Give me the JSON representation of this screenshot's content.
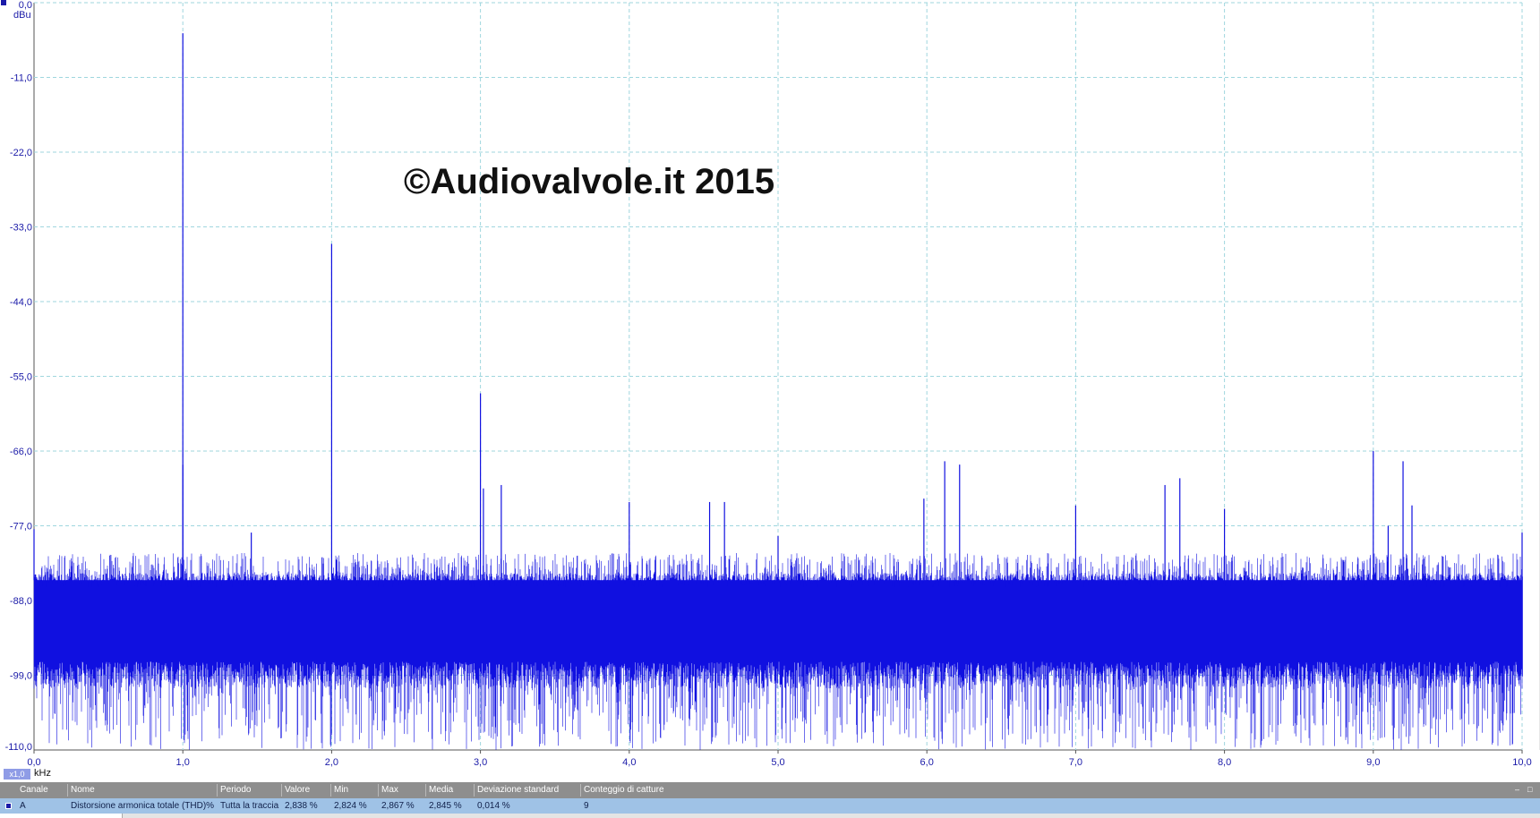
{
  "chart_data": {
    "type": "line",
    "xlabel": "kHz",
    "ylabel": "dBu",
    "xlim": [
      0.0,
      10.0
    ],
    "ylim": [
      -110.0,
      0.0
    ],
    "x_ticks": [
      "0,0",
      "1,0",
      "2,0",
      "3,0",
      "4,0",
      "5,0",
      "6,0",
      "7,0",
      "8,0",
      "9,0",
      "10,0"
    ],
    "y_ticks": [
      "0,0",
      "-11,0",
      "-22,0",
      "-33,0",
      "-44,0",
      "-55,0",
      "-66,0",
      "-77,0",
      "-88,0",
      "-99,0",
      "-110,0"
    ],
    "grid": true,
    "series_color": "#1010e0",
    "zoom_label": "x1,0",
    "watermark": "©Audiovalvole.it 2015",
    "noise_floor": {
      "top_db": -81,
      "band_top_db": -85,
      "band_bottom_db": -97,
      "lowest_db": -110
    },
    "peaks": [
      {
        "x": 1.0,
        "y": -4.5
      },
      {
        "x": 2.0,
        "y": -35.5
      },
      {
        "x": 3.0,
        "y": -57.5
      },
      {
        "x": 1.0,
        "y": -68.0
      },
      {
        "x": 6.12,
        "y": -67.5
      },
      {
        "x": 6.22,
        "y": -68.0
      },
      {
        "x": 9.0,
        "y": -66.0
      },
      {
        "x": 9.2,
        "y": -67.5
      },
      {
        "x": 3.14,
        "y": -71.0
      },
      {
        "x": 3.02,
        "y": -71.5
      },
      {
        "x": 5.98,
        "y": -73.0
      },
      {
        "x": 7.7,
        "y": -70.0
      },
      {
        "x": 7.6,
        "y": -71.0
      },
      {
        "x": 4.54,
        "y": -73.5
      },
      {
        "x": 4.64,
        "y": -73.5
      },
      {
        "x": 4.0,
        "y": -73.5
      },
      {
        "x": 7.0,
        "y": -74.0
      },
      {
        "x": 8.0,
        "y": -74.5
      },
      {
        "x": 9.26,
        "y": -74.0
      },
      {
        "x": 1.46,
        "y": -78.0
      },
      {
        "x": 5.0,
        "y": -78.5
      },
      {
        "x": 9.1,
        "y": -77.0
      },
      {
        "x": 0.0,
        "y": -77.5
      },
      {
        "x": 10.0,
        "y": -78.0
      }
    ]
  },
  "measurements": {
    "columns": [
      "Canale",
      "Nome",
      "Periodo",
      "Valore",
      "Min",
      "Max",
      "Media",
      "Deviazione standard",
      "Conteggio di catture"
    ],
    "rows": [
      [
        "A",
        "Distorsione armonica totale (THD)%",
        "Tutta la traccia",
        "2,838 %",
        "2,824 %",
        "2,867 %",
        "2,845 %",
        "0,014 %",
        "9"
      ]
    ],
    "panel_buttons": [
      "–",
      "□"
    ]
  }
}
